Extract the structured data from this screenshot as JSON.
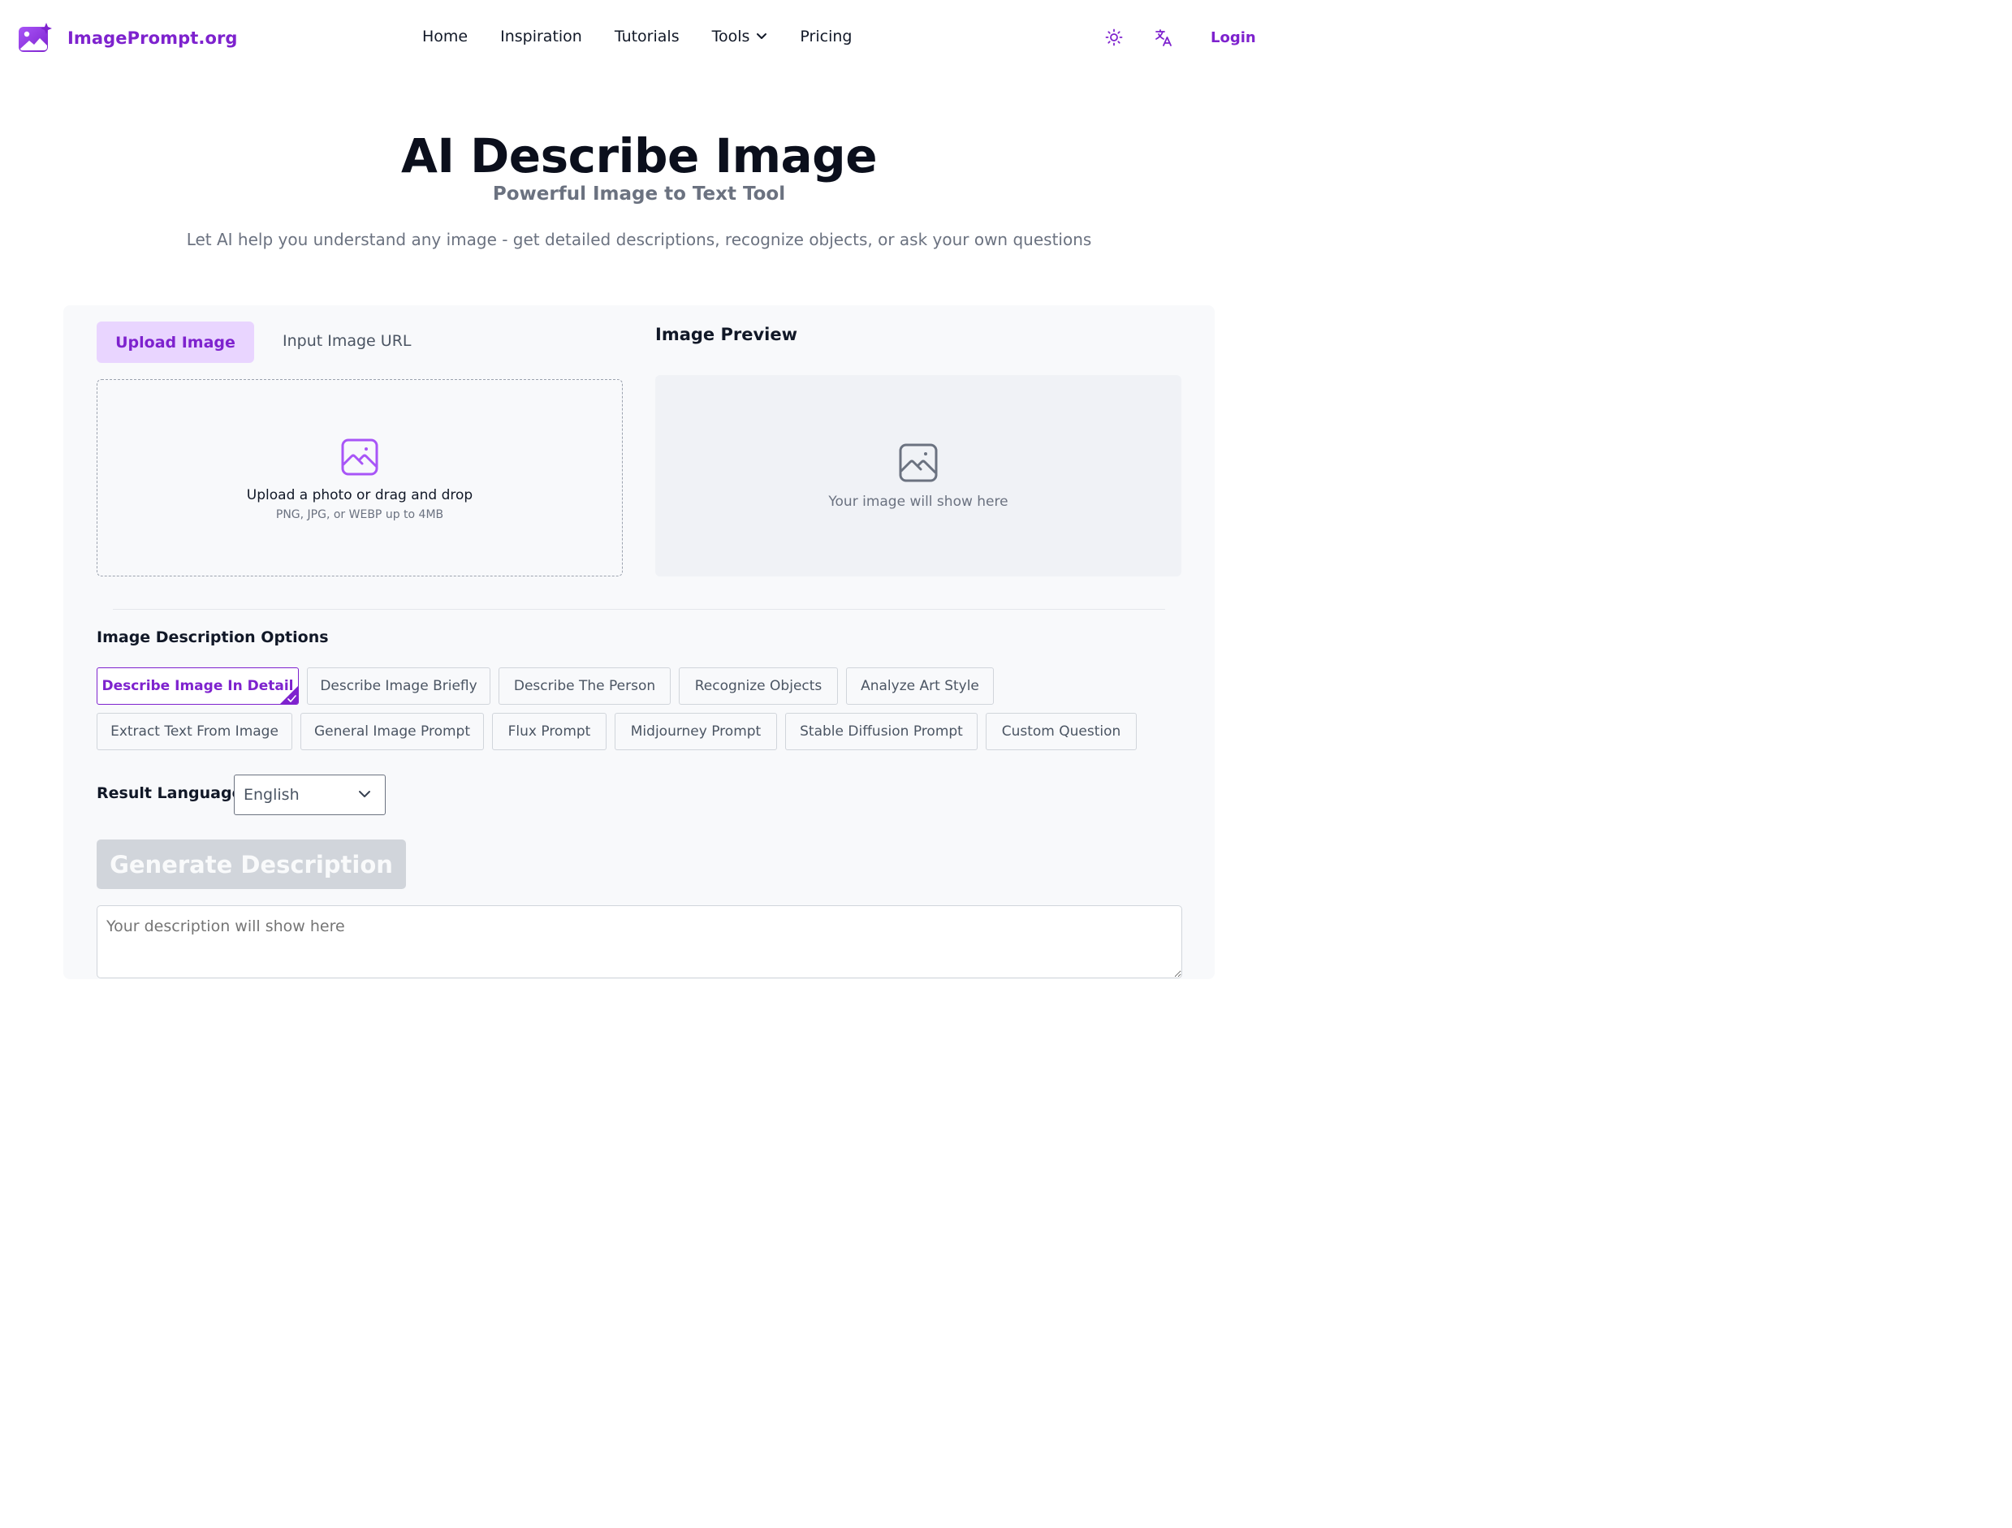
{
  "brand": {
    "name": "ImagePrompt.org"
  },
  "nav": {
    "home": "Home",
    "inspiration": "Inspiration",
    "tutorials": "Tutorials",
    "tools": "Tools",
    "pricing": "Pricing"
  },
  "header": {
    "theme_icon": "sun-icon",
    "language_icon": "translate-icon",
    "login": "Login"
  },
  "hero": {
    "title": "AI Describe Image",
    "subtitle": "Powerful Image to Text Tool",
    "description": "Let AI help you understand any image - get detailed descriptions, recognize objects, or ask your own questions"
  },
  "upload": {
    "tabs": [
      "Upload Image",
      "Input Image URL"
    ],
    "active_tab": "Upload Image",
    "dropzone_text": "Upload a photo or drag and drop",
    "dropzone_hint": "PNG, JPG, or WEBP up to 4MB"
  },
  "preview": {
    "title": "Image Preview",
    "placeholder": "Your image will show here"
  },
  "options": {
    "title": "Image Description Options",
    "selected": "Describe Image In Detail",
    "items": [
      "Describe Image In Detail",
      "Describe Image Briefly",
      "Describe The Person",
      "Recognize Objects",
      "Analyze Art Style",
      "Extract Text From Image",
      "General Image Prompt",
      "Flux Prompt",
      "Midjourney Prompt",
      "Stable Diffusion Prompt",
      "Custom Question"
    ]
  },
  "language": {
    "label": "Result Language",
    "value": "English"
  },
  "generate": {
    "label": "Generate Description"
  },
  "result": {
    "placeholder": "Your description will show here"
  },
  "colors": {
    "accent": "#7e22ce",
    "accent_light": "#e9d5ff",
    "panel_bg": "#f8f9fb",
    "disabled_button": "#d1d5db"
  }
}
